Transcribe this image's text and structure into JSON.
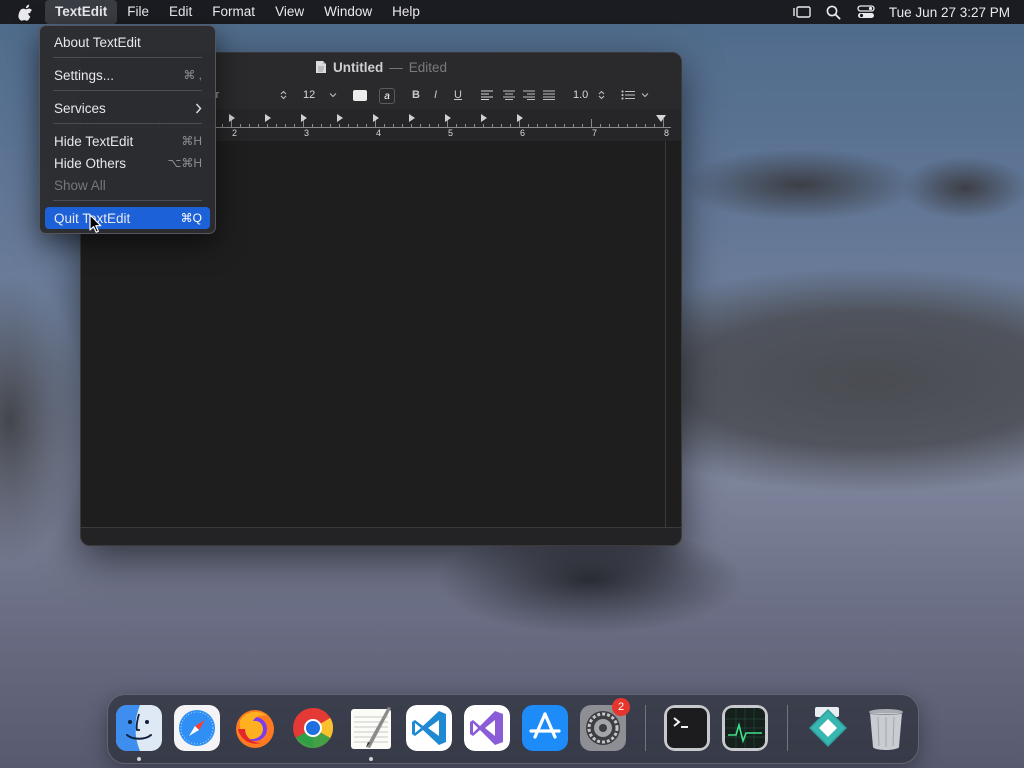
{
  "menubar": {
    "items": [
      {
        "label": "TextEdit"
      },
      {
        "label": "File"
      },
      {
        "label": "Edit"
      },
      {
        "label": "Format"
      },
      {
        "label": "View"
      },
      {
        "label": "Window"
      },
      {
        "label": "Help"
      }
    ],
    "clock": "Tue Jun 27  3:27 PM"
  },
  "window": {
    "title": "Untitled",
    "separator": "—",
    "state": "Edited"
  },
  "formatbar": {
    "font_style": "ular",
    "font_size": "12",
    "highlight_glyph": "a",
    "bold": "B",
    "italic": "I",
    "underline": "U",
    "line_spacing": "1.0"
  },
  "ruler": {
    "numbers": [
      "2",
      "3",
      "4",
      "5",
      "6",
      "7",
      "8"
    ]
  },
  "app_menu": {
    "items": [
      {
        "label": "About TextEdit",
        "shortcut": ""
      },
      {
        "label": "Settings...",
        "shortcut": "⌘ ,"
      },
      {
        "label": "Services",
        "shortcut": ""
      },
      {
        "label": "Hide TextEdit",
        "shortcut": "⌘H"
      },
      {
        "label": "Hide Others",
        "shortcut": "⌥⌘H"
      },
      {
        "label": "Show All",
        "shortcut": ""
      },
      {
        "label": "Quit TextEdit",
        "shortcut": "⌘Q"
      }
    ]
  },
  "dock": {
    "apps": [
      {
        "icon": "finder-icon",
        "running": true
      },
      {
        "icon": "safari-icon",
        "running": false
      },
      {
        "icon": "firefox-icon",
        "running": false
      },
      {
        "icon": "chrome-icon",
        "running": false
      },
      {
        "icon": "textedit-icon",
        "running": true
      },
      {
        "icon": "vscode-icon",
        "running": false
      },
      {
        "icon": "visual-studio-icon",
        "running": false
      },
      {
        "icon": "app-store-icon",
        "running": false
      },
      {
        "icon": "system-settings-icon",
        "running": false,
        "badge": "2"
      },
      {
        "icon": "terminal-icon",
        "running": false
      },
      {
        "icon": "activity-monitor-icon",
        "running": false
      },
      {
        "icon": "downloads-stack-icon",
        "running": false
      },
      {
        "icon": "trash-icon",
        "running": false
      }
    ]
  },
  "colors": {
    "menu_highlight": "#1d61d9",
    "menubar_bg": "#1b1c21",
    "badge": "#e5352d"
  }
}
